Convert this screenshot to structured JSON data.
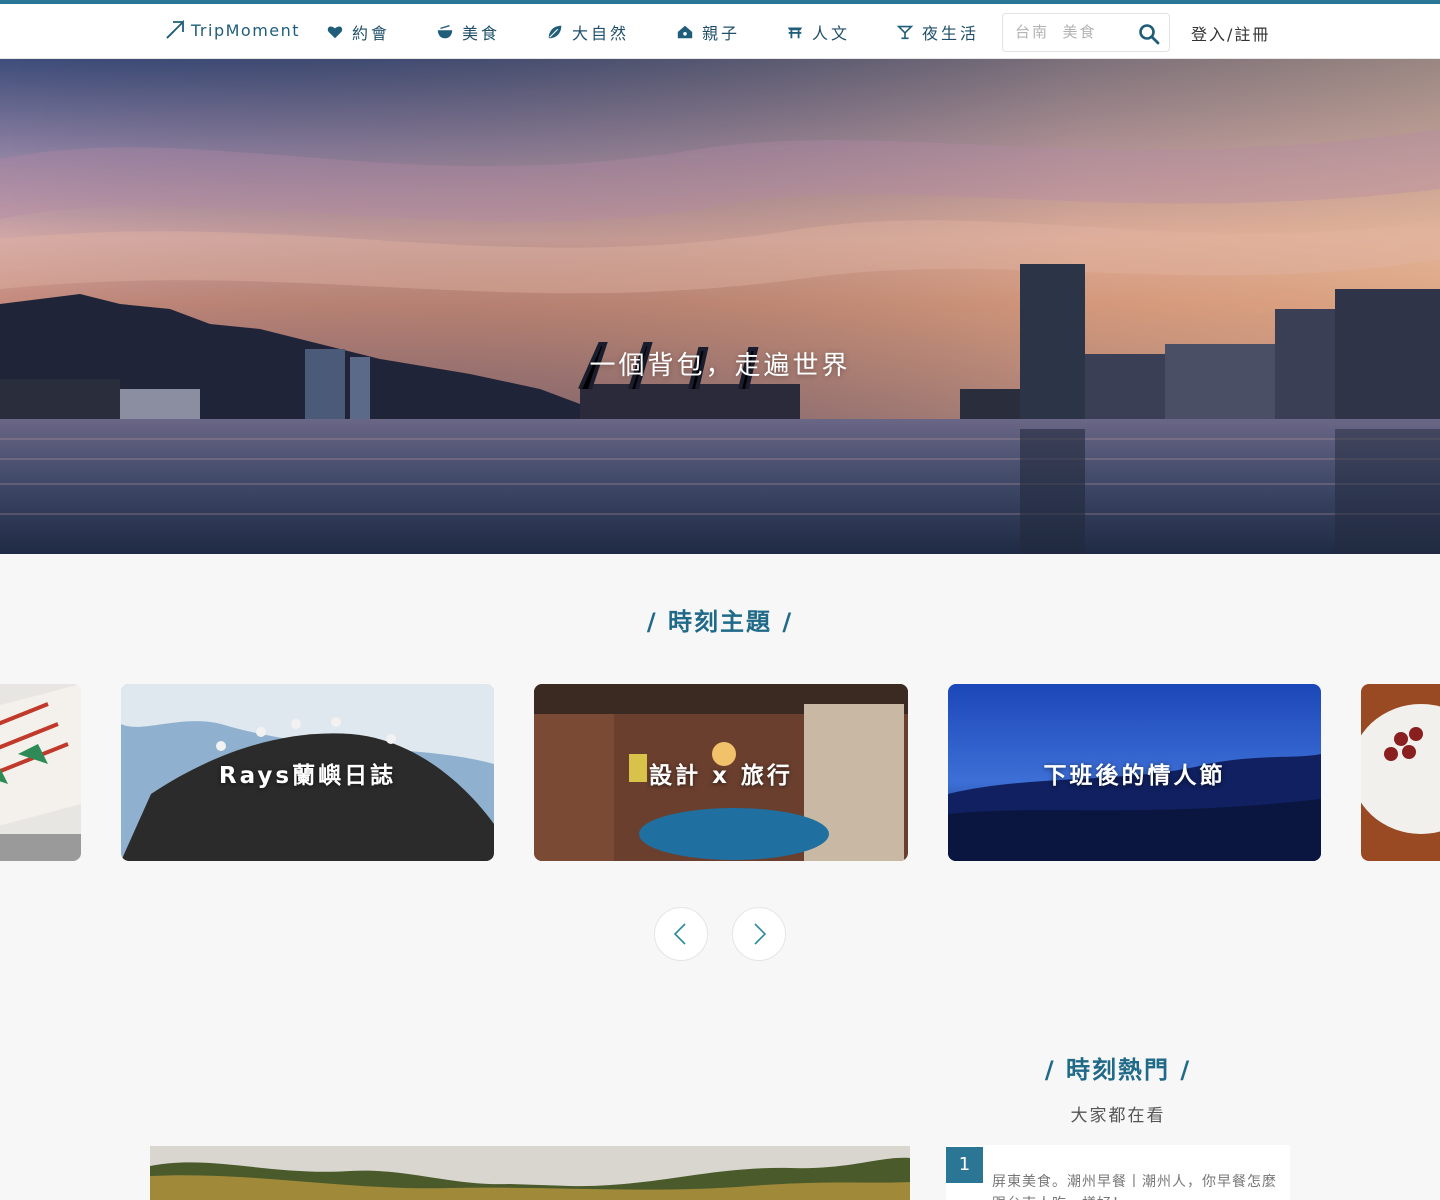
{
  "header": {
    "logo": "TripMoment",
    "nav": [
      {
        "label": "約會",
        "icon": "heart-icon"
      },
      {
        "label": "美食",
        "icon": "bowl-icon"
      },
      {
        "label": "大自然",
        "icon": "leaf-icon"
      },
      {
        "label": "親子",
        "icon": "house-icon"
      },
      {
        "label": "人文",
        "icon": "temple-icon"
      },
      {
        "label": "夜生活",
        "icon": "cocktail-icon"
      }
    ],
    "search": {
      "placeholder": "台南  美食"
    },
    "auth": "登入/註冊"
  },
  "hero": {
    "title": "一個背包，走遍世界"
  },
  "themes": {
    "title": "/ 時刻主題 /",
    "cards": [
      {
        "label": ""
      },
      {
        "label": "Rays蘭嶼日誌"
      },
      {
        "label": "設計 x 旅行"
      },
      {
        "label": "下班後的情人節"
      },
      {
        "label": ""
      }
    ]
  },
  "hot": {
    "title": "/ 時刻熱門 /",
    "subtitle": "大家都在看",
    "items": [
      {
        "rank": "1",
        "title": "屏東美食。潮州早餐丨潮州人，你早餐怎麼跟台南人吃一樣好！"
      }
    ]
  },
  "colors": {
    "accent": "#2a7694",
    "nav_text": "#1f4f6a"
  }
}
